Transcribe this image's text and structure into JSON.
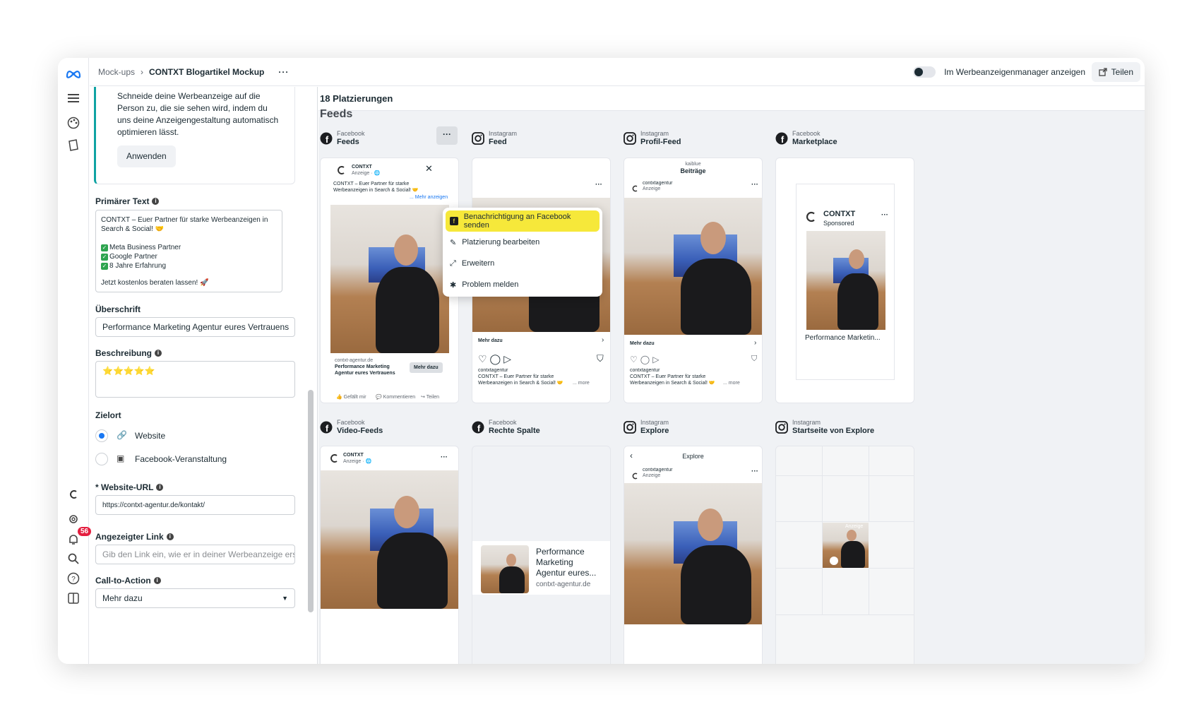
{
  "topbar": {
    "breadcrumb_root": "Mock-ups",
    "breadcrumb_current": "CONTXT Blogartikel Mockup",
    "more": "···",
    "toggle_label": "Im Werbeanzeigenmanager anzeigen",
    "share_label": "Teilen"
  },
  "rail": {
    "notification_count": "56"
  },
  "form": {
    "tip_text": "Schneide deine Werbeanzeige auf die Person zu, die sie sehen wird, indem du uns deine Anzeigengestaltung automatisch optimieren lässt.",
    "apply_label": "Anwenden",
    "primary_text_label": "Primärer Text",
    "primary_text_line1": "CONTXT – Euer Partner für starke Werbeanzeigen in Search & Social! 🤝",
    "primary_text_check1": "Meta Business Partner",
    "primary_text_check2": "Google Partner",
    "primary_text_check3": "8 Jahre Erfahrung",
    "primary_text_cta": "Jetzt kostenlos beraten lassen! 🚀",
    "headline_label": "Überschrift",
    "headline_value": "Performance Marketing Agentur eures Vertrauens",
    "description_label": "Beschreibung",
    "description_value": "⭐⭐⭐⭐⭐",
    "destination_label": "Zielort",
    "dest_option1": "Website",
    "dest_option2": "Facebook-Veranstaltung",
    "url_label": "* Website-URL",
    "url_value": "https://contxt-agentur.de/kontakt/",
    "display_link_label": "Angezeigter Link",
    "display_link_placeholder": "Gib den Link ein, wie er in deiner Werbeanzeige erscheinen soll",
    "cta_label": "Call-to-Action",
    "cta_value": "Mehr dazu"
  },
  "preview": {
    "count_title": "18 Platzierungen",
    "section": "Feeds",
    "placements": [
      {
        "platform": "Facebook",
        "type": "Feeds"
      },
      {
        "platform": "Instagram",
        "type": "Feed"
      },
      {
        "platform": "Instagram",
        "type": "Profil-Feed"
      },
      {
        "platform": "Facebook",
        "type": "Marketplace"
      },
      {
        "platform": "Facebook",
        "type": "Video-Feeds"
      },
      {
        "platform": "Facebook",
        "type": "Rechte Spalte"
      },
      {
        "platform": "Instagram",
        "type": "Explore"
      },
      {
        "platform": "Instagram",
        "type": "Startseite von Explore"
      }
    ],
    "menu": {
      "item1": "Benachrichtigung an Facebook senden",
      "item2": "Platzierung bearbeiten",
      "item3": "Erweitern",
      "item4": "Problem melden"
    },
    "fb_card": {
      "brand": "CONTXT",
      "sponsored": "Anzeige · 🌐",
      "text": "CONTXT – Euer Partner für starke Werbeanzeigen in Search & Social! 🤝",
      "more": "... Mehr anzeigen",
      "domain": "contxt-agentur.de",
      "headline": "Performance Marketing Agentur eures Vertrauens",
      "button": "Mehr dazu",
      "like": "Gefällt mir",
      "comment": "Kommentieren",
      "share": "Teilen"
    },
    "ig_card": {
      "cta": "Mehr dazu",
      "account": "contxtagentur",
      "sponsored": "Anzeige",
      "caption": "CONTXT – Euer Partner für starke Werbeanzeigen in Search & Social! 🤝",
      "more": "... more"
    },
    "profile_card": {
      "kicker": "kaiblue",
      "title": "Beiträge"
    },
    "market_card": {
      "brand": "CONTXT",
      "sponsored": "Sponsored",
      "headline": "Performance Marketin..."
    },
    "right_col_card": {
      "headline": "Performance Marketing Agentur eures...",
      "domain": "contxt-agentur.de"
    },
    "explore_card": {
      "title": "Explore"
    },
    "explore_home_card": {
      "badge": "Anzeige"
    }
  }
}
